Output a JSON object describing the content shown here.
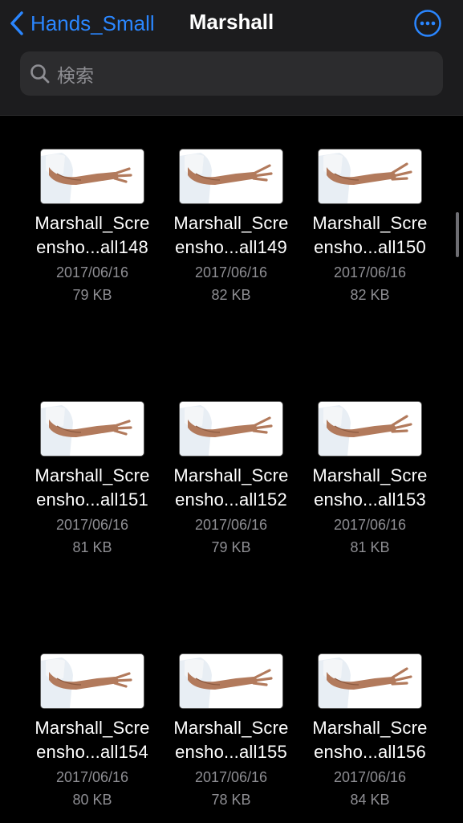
{
  "nav": {
    "back_label": "Hands_Small",
    "title": "Marshall",
    "accent": "#2a86ff"
  },
  "search": {
    "placeholder": "検索"
  },
  "files": [
    {
      "name_line1": "Marshall_Scre",
      "name_line2": "ensho...all148",
      "date": "2017/06/16",
      "size": "79 KB"
    },
    {
      "name_line1": "Marshall_Scre",
      "name_line2": "ensho...all149",
      "date": "2017/06/16",
      "size": "82 KB"
    },
    {
      "name_line1": "Marshall_Scre",
      "name_line2": "ensho...all150",
      "date": "2017/06/16",
      "size": "82 KB"
    },
    {
      "name_line1": "Marshall_Scre",
      "name_line2": "ensho...all151",
      "date": "2017/06/16",
      "size": "81 KB"
    },
    {
      "name_line1": "Marshall_Scre",
      "name_line2": "ensho...all152",
      "date": "2017/06/16",
      "size": "79 KB"
    },
    {
      "name_line1": "Marshall_Scre",
      "name_line2": "ensho...all153",
      "date": "2017/06/16",
      "size": "81 KB"
    },
    {
      "name_line1": "Marshall_Scre",
      "name_line2": "ensho...all154",
      "date": "2017/06/16",
      "size": "80 KB"
    },
    {
      "name_line1": "Marshall_Scre",
      "name_line2": "ensho...all155",
      "date": "2017/06/16",
      "size": "78 KB"
    },
    {
      "name_line1": "Marshall_Scre",
      "name_line2": "ensho...all156",
      "date": "2017/06/16",
      "size": "84 KB"
    }
  ]
}
